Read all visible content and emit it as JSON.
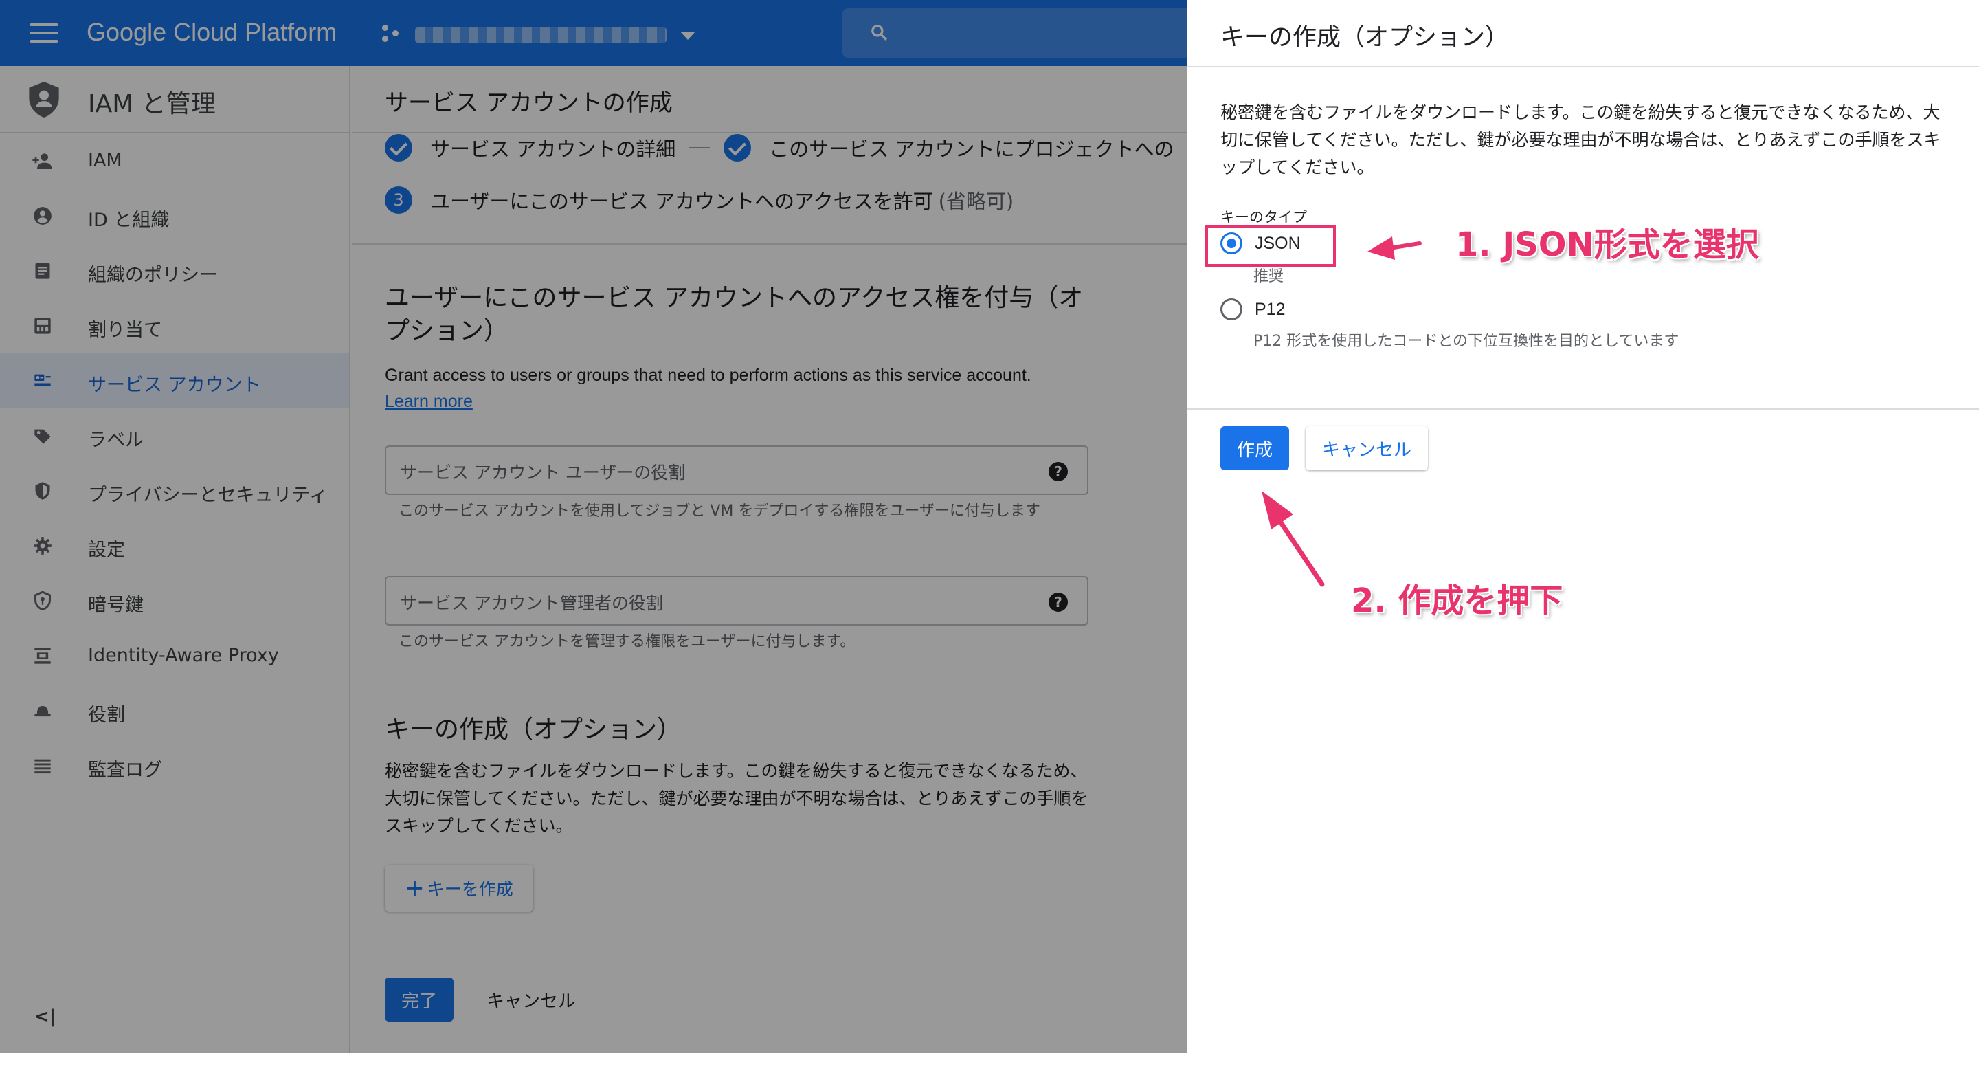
{
  "topbar": {
    "product_name": "Google Cloud Platform"
  },
  "sidebar": {
    "section_title": "IAM と管理",
    "items": [
      {
        "label": "IAM",
        "icon": "person-add-icon",
        "active": false
      },
      {
        "label": "ID と組織",
        "icon": "account-circle-icon",
        "active": false
      },
      {
        "label": "組織のポリシー",
        "icon": "policy-doc-icon",
        "active": false
      },
      {
        "label": "割り当て",
        "icon": "quota-icon",
        "active": false
      },
      {
        "label": "サービス アカウント",
        "icon": "service-account-icon",
        "active": true
      },
      {
        "label": "ラベル",
        "icon": "label-tag-icon",
        "active": false
      },
      {
        "label": "プライバシーとセキュリティ",
        "icon": "security-shield-icon",
        "active": false
      },
      {
        "label": "設定",
        "icon": "gear-icon",
        "active": false
      },
      {
        "label": "暗号鍵",
        "icon": "crypto-key-shield-icon",
        "active": false
      },
      {
        "label": "Identity-Aware Proxy",
        "icon": "iap-icon",
        "active": false
      },
      {
        "label": "役割",
        "icon": "roles-hat-icon",
        "active": false
      },
      {
        "label": "監査ログ",
        "icon": "audit-list-icon",
        "active": false
      }
    ],
    "collapse_label": "<|"
  },
  "main": {
    "page_title": "サービス アカウントの作成",
    "steps": {
      "step1": "サービス アカウントの詳細",
      "step2": "このサービス アカウントにプロジェクトへの",
      "step3_number": "3",
      "step3": "ユーザーにこのサービス アカウントへのアクセスを許可",
      "step3_optional": "(省略可)"
    },
    "grant_section": {
      "title": "ユーザーにこのサービス アカウントへのアクセス権を付与（オプション）",
      "description": "Grant access to users or groups that need to perform actions as this service account.",
      "learn_more": "Learn more",
      "user_role_label": "サービス アカウント ユーザーの役割",
      "user_role_hint": "このサービス アカウントを使用してジョブと VM をデプロイする権限をユーザーに付与します",
      "admin_role_label": "サービス アカウント管理者の役割",
      "admin_role_hint": "このサービス アカウントを管理する権限をユーザーに付与します。"
    },
    "key_section": {
      "title": "キーの作成（オプション）",
      "description": "秘密鍵を含むファイルをダウンロードします。この鍵を紛失すると復元できなくなるため、大切に保管してください。ただし、鍵が必要な理由が不明な場合は、とりあえずこの手順をスキップしてください。",
      "add_key_button": "キーを作成"
    },
    "done_button": "完了",
    "cancel_button": "キャンセル"
  },
  "panel": {
    "title": "キーの作成（オプション）",
    "description": "秘密鍵を含むファイルをダウンロードします。この鍵を紛失すると復元できなくなるため、大切に保管してください。ただし、鍵が必要な理由が不明な場合は、とりあえずこの手順をスキップしてください。",
    "key_type_label": "キーのタイプ",
    "options": [
      {
        "label": "JSON",
        "sub": "推奨",
        "selected": true
      },
      {
        "label": "P12",
        "sub": "P12 形式を使用したコードとの下位互換性を目的としています",
        "selected": false
      }
    ],
    "create_button": "作成",
    "cancel_button": "キャンセル"
  },
  "annotations": {
    "step1": "1. JSON形式を選択",
    "step2": "2. 作成を押下",
    "color": "#e8336d"
  },
  "colors": {
    "primary": "#1a73e8",
    "active_nav_bg": "#e8f0fe",
    "annotation": "#e8336d"
  }
}
